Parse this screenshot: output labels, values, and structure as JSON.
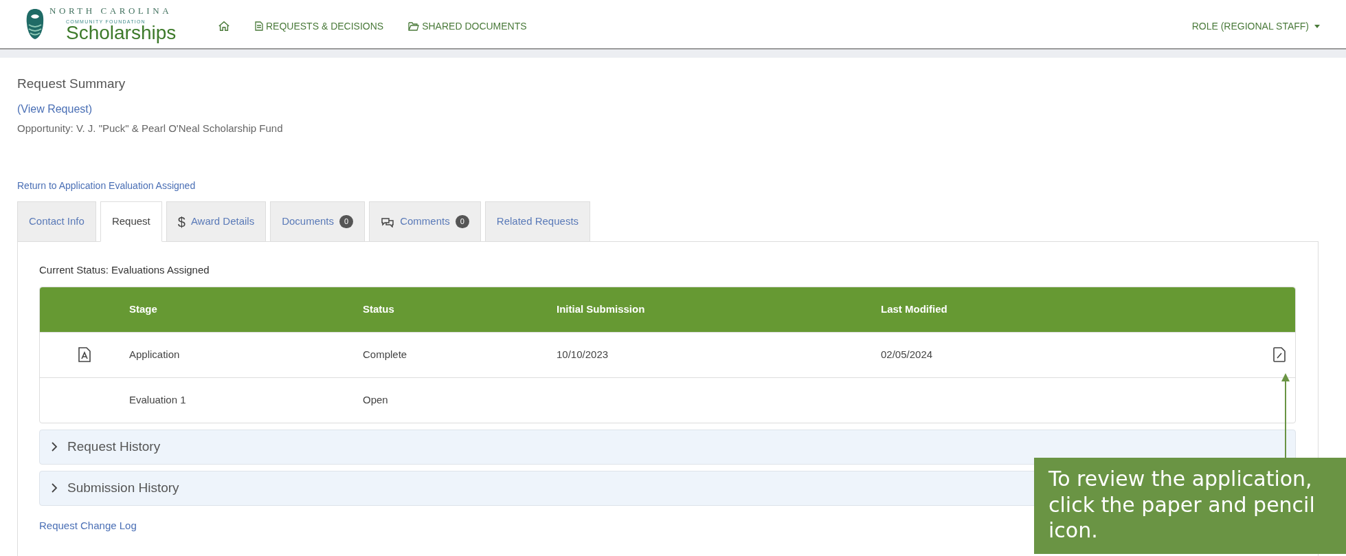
{
  "header": {
    "logo": {
      "line1": "NORTH CAROLINA",
      "line2": "COMMUNITY FOUNDATION",
      "line3": "Scholarships"
    },
    "nav": [
      {
        "kind": "home"
      },
      {
        "kind": "doc",
        "label": "REQUESTS & DECISIONS"
      },
      {
        "kind": "folder",
        "label": "SHARED DOCUMENTS"
      }
    ],
    "role_menu": "ROLE (REGIONAL STAFF)"
  },
  "title": "Request Summary",
  "view_link": "(View Request)",
  "opportunity": "Opportunity: V. J. \"Puck\" & Pearl O'Neal Scholarship Fund",
  "return_link": "Return to Application Evaluation Assigned",
  "tabs": [
    {
      "label": "Contact Info",
      "selected": false
    },
    {
      "label": "Request",
      "selected": true
    },
    {
      "label": "Award Details",
      "icon": "$",
      "selected": false
    },
    {
      "label": "Documents",
      "count": "0",
      "selected": false
    },
    {
      "label": "Comments",
      "chat": true,
      "count": "0",
      "selected": false
    },
    {
      "label": "Related Requests",
      "selected": false
    }
  ],
  "current_status": "Current Status: Evaluations Assigned",
  "table": {
    "columns": [
      "Stage",
      "Status",
      "Initial Submission",
      "Last Modified"
    ],
    "rows": [
      {
        "pdf": true,
        "cells": [
          "Application",
          "Complete",
          "10/10/2023",
          "02/05/2024"
        ],
        "edit": true
      },
      {
        "pdf": false,
        "cells": [
          "Evaluation 1",
          "Open",
          "",
          ""
        ],
        "edit": false
      }
    ]
  },
  "sections": [
    {
      "label": "Request History",
      "expanded": false
    },
    {
      "label": "Submission History",
      "expanded": false
    }
  ],
  "change_log_link": "Request Change Log",
  "callout": "To review the application, click the paper and pencil icon."
}
